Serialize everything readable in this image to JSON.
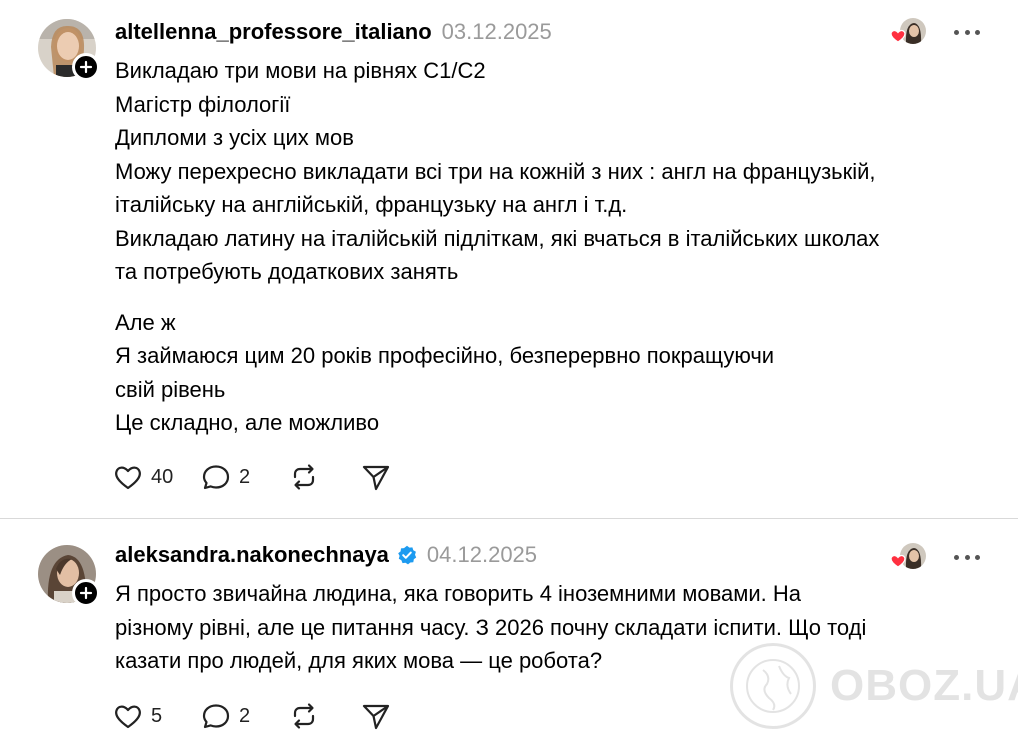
{
  "posts": [
    {
      "username": "altellenna_professore_italiano",
      "verified": false,
      "date": "03.12.2025",
      "paragraphs": [
        [
          "Викладаю три мови на рівнях С1/С2",
          "Магістр філології",
          "Дипломи з усіх цих мов",
          "Можу перехресно викладати всі три на кожній з них : англ на французькій,",
          "італійську на англійській, французьку на англ і т.д.",
          "Викладаю латину на італійській підліткам, які вчаться в італійських школах",
          "та потребують додаткових занять"
        ],
        [
          "Але ж",
          "Я займаюся цим 20 років професійно, безперервно покращуючи",
          "свій рівень",
          "Це складно, але можливо"
        ]
      ],
      "likes": "40",
      "replies": "2"
    },
    {
      "username": "aleksandra.nakonechnaya",
      "verified": true,
      "date": "04.12.2025",
      "paragraphs": [
        [
          "Я просто звичайна людина, яка говорить 4 іноземними мовами. На",
          "різному рівні, але це питання часу. З 2026 почну складати іспити. Що тоді",
          "казати про людей, для яких мова — це робота?"
        ]
      ],
      "likes": "5",
      "replies": "2"
    }
  ],
  "watermark": {
    "text": "OBOZ.UA"
  },
  "icons": {
    "like": "heart-outline-icon",
    "reply": "speech-bubble-icon",
    "repost": "repost-arrows-icon",
    "share": "paper-plane-icon",
    "more": "more-dots-icon",
    "follow": "plus-icon",
    "verified": "verified-badge-icon"
  },
  "colors": {
    "verified_blue": "#1d9bf0",
    "like_red": "#ff3040",
    "date_gray": "#9a9a9a",
    "divider": "#d9d9d9"
  }
}
